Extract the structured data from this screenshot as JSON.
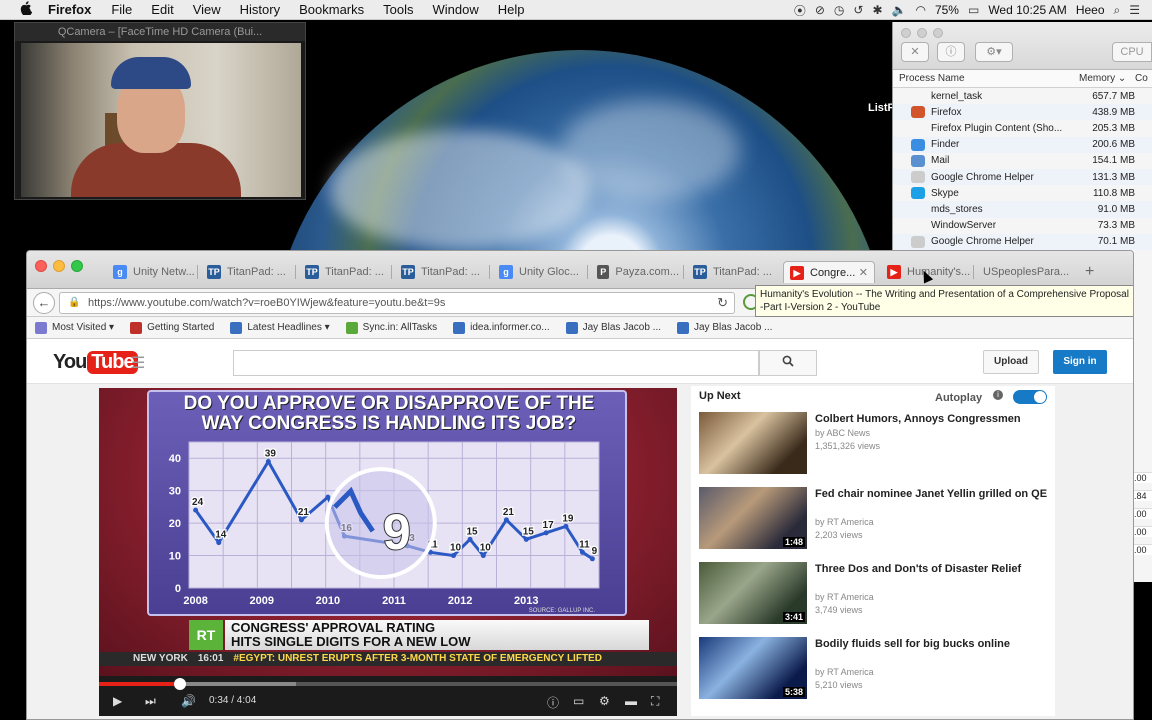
{
  "menubar": {
    "apple": "",
    "app_name": "Firefox",
    "items": [
      "File",
      "Edit",
      "View",
      "History",
      "Bookmarks",
      "Tools",
      "Window",
      "Help"
    ],
    "battery": "75%",
    "clock": "Wed 10:25 AM",
    "user": "Heeo"
  },
  "qcamera": {
    "title": "QCamera – [FaceTime HD Camera (Bui..."
  },
  "desktop": {
    "listf_label": "ListF"
  },
  "activity_monitor": {
    "cpu_tab": "CPU",
    "col_process": "Process Name",
    "col_memory": "Memory",
    "col_extra": "Co",
    "processes": [
      {
        "name": "kernel_task",
        "memory": "657.7 MB",
        "icon_color": ""
      },
      {
        "name": "Firefox",
        "memory": "438.9 MB",
        "icon_color": "#d2542a"
      },
      {
        "name": "Firefox Plugin Content (Sho...",
        "memory": "205.3 MB",
        "icon_color": ""
      },
      {
        "name": "Finder",
        "memory": "200.6 MB",
        "icon_color": "#3a8de0"
      },
      {
        "name": "Mail",
        "memory": "154.1 MB",
        "icon_color": "#5a8fd0"
      },
      {
        "name": "Google Chrome Helper",
        "memory": "131.3 MB",
        "icon_color": "#cccccc"
      },
      {
        "name": "Skype",
        "memory": "110.8 MB",
        "icon_color": "#1ea0e6"
      },
      {
        "name": "mds_stores",
        "memory": "91.0 MB",
        "icon_color": ""
      },
      {
        "name": "WindowServer",
        "memory": "73.3 MB",
        "icon_color": ""
      },
      {
        "name": "Google Chrome Helper",
        "memory": "70.1 MB",
        "icon_color": "#cccccc"
      }
    ],
    "side_values": [
      ".00",
      ".84",
      ".00",
      ".00",
      ".00"
    ]
  },
  "firefox": {
    "tabs": [
      {
        "label": "Unity Netw...",
        "icon_letter": "g",
        "icon_color": "#4a8af4",
        "active": false
      },
      {
        "label": "TitanPad: ...",
        "icon_letter": "TP",
        "icon_color": "#2b5d9a",
        "active": false
      },
      {
        "label": "TitanPad: ...",
        "icon_letter": "TP",
        "icon_color": "#2b5d9a",
        "active": false
      },
      {
        "label": "TitanPad: ...",
        "icon_letter": "TP",
        "icon_color": "#2b5d9a",
        "active": false
      },
      {
        "label": "Unity Gloc...",
        "icon_letter": "g",
        "icon_color": "#4a8af4",
        "active": false
      },
      {
        "label": "Payza.com...",
        "icon_letter": "P",
        "icon_color": "#555555",
        "active": false
      },
      {
        "label": "TitanPad: ...",
        "icon_letter": "TP",
        "icon_color": "#2b5d9a",
        "active": false
      },
      {
        "label": "Congre...",
        "icon_letter": "▶",
        "icon_color": "#e62117",
        "active": true
      },
      {
        "label": "Humanity's...",
        "icon_letter": "▶",
        "icon_color": "#e62117",
        "active": false
      },
      {
        "label": "USpeoplesPara...",
        "icon_letter": "",
        "icon_color": "",
        "active": false
      }
    ],
    "new_tab": "+",
    "url": "https://www.youtube.com/watch?v=roeB0YIWjew&feature=youtu.be&t=9s",
    "tooltip": "Humanity's Evolution -- The Writing and Presentation of a Comprehensive Proposal -Part I-Version 2 - YouTube",
    "bookmarks": [
      {
        "label": "Most Visited ▾",
        "icon_color": "#7a7ad0"
      },
      {
        "label": "Getting Started",
        "icon_color": "#c0302a"
      },
      {
        "label": "Latest Headlines ▾",
        "icon_color": "#3a6fc0"
      },
      {
        "label": "Sync.in: AllTasks",
        "icon_color": "#5aa83a"
      },
      {
        "label": "idea.informer.co...",
        "icon_color": "#3a6fc0"
      },
      {
        "label": "Jay Blas Jacob ...",
        "icon_color": "#3a6fc0"
      },
      {
        "label": "Jay Blas Jacob ...",
        "icon_color": "#3a6fc0"
      }
    ]
  },
  "youtube": {
    "logo_you": "You",
    "logo_tube": "Tube",
    "upload": "Upload",
    "sign_in": "Sign in",
    "video": {
      "chart_title_line1": "DO YOU APPROVE OR DISAPPROVE OF THE",
      "chart_title_line2": "WAY CONGRESS IS HANDLING ITS JOB?",
      "highlight_value": "9",
      "source": "SOURCE: GALLUP INC.",
      "rt_logo": "RT",
      "headline_line1": "CONGRESS' APPROVAL RATING",
      "headline_line2": "HITS SINGLE DIGITS FOR A NEW LOW",
      "ticker_city": "NEW YORK",
      "ticker_time": "16:01",
      "ticker_news": "#EGYPT: UNREST ERUPTS AFTER 3-MONTH STATE OF EMERGENCY LIFTED",
      "time_display": "0:34 / 4:04",
      "progress_fraction": 0.14,
      "buffer_fraction": 0.34
    },
    "sidebar": {
      "up_next": "Up Next",
      "autoplay": "Autoplay",
      "videos": [
        {
          "title": "Colbert Humors, Annoys Congressmen",
          "channel": "by ABC News",
          "views": "1,351,326 views",
          "duration": ""
        },
        {
          "title": "Fed chair nominee Janet Yellin grilled on QE",
          "channel": "by RT America",
          "views": "2,203 views",
          "duration": "1:48"
        },
        {
          "title": "Three Dos and Don'ts of Disaster Relief",
          "channel": "by RT America",
          "views": "3,749 views",
          "duration": "3:41"
        },
        {
          "title": "Bodily fluids sell for big bucks online",
          "channel": "by RT America",
          "views": "5,210 views",
          "duration": "5:38"
        }
      ]
    }
  },
  "chart_data": {
    "type": "line",
    "title": "DO YOU APPROVE OR DISAPPROVE OF THE WAY CONGRESS IS HANDLING ITS JOB?",
    "xlabel": "",
    "ylabel": "",
    "x_ticks": [
      "2008",
      "2009",
      "2010",
      "2011",
      "2012",
      "2013"
    ],
    "y_ticks": [
      0,
      10,
      20,
      30,
      40
    ],
    "ylim": [
      0,
      45
    ],
    "xlim": [
      2007.9,
      2014.1
    ],
    "series": [
      {
        "x": [
          2008.0,
          2008.35,
          2009.1,
          2009.6,
          2010.0,
          2010.25,
          2011.2,
          2011.55,
          2011.9,
          2012.15,
          2012.35,
          2012.7,
          2013.0,
          2013.3,
          2013.6,
          2013.85,
          2014.0
        ],
        "values": [
          24,
          14,
          39,
          21,
          28,
          16,
          13,
          11,
          10,
          15,
          10,
          21,
          15,
          17,
          19,
          11,
          9
        ],
        "labels": [
          "24",
          "14",
          "39",
          "21",
          "",
          "16",
          "13",
          "11",
          "10",
          "15",
          "10",
          "21",
          "15",
          "17",
          "19",
          "11",
          "9"
        ]
      }
    ],
    "grid": true
  }
}
